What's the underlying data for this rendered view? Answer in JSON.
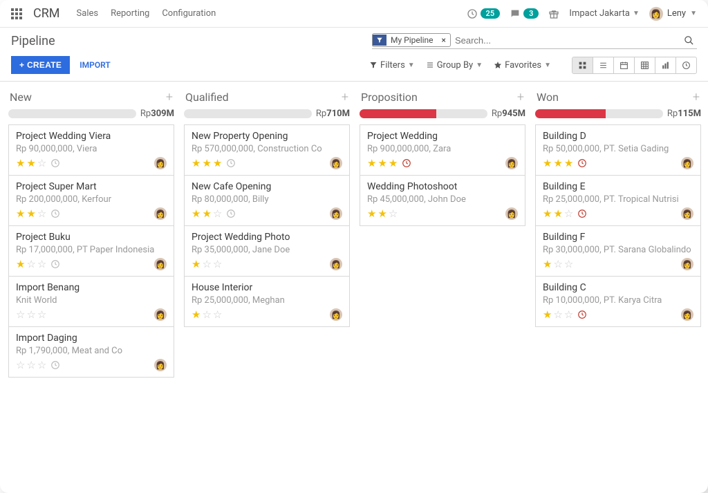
{
  "topbar": {
    "brand": "CRM",
    "nav": [
      "Sales",
      "Reporting",
      "Configuration"
    ],
    "activity_count": "25",
    "message_count": "3",
    "company": "Impact Jakarta",
    "user": "Leny"
  },
  "subbar": {
    "title": "Pipeline",
    "filter_chip": "My Pipeline",
    "search_placeholder": "Search..."
  },
  "toolbar": {
    "create": "CREATE",
    "import": "IMPORT",
    "filters": "Filters",
    "groupby": "Group By",
    "favorites": "Favorites"
  },
  "columns": [
    {
      "name": "New",
      "currency": "Rp",
      "total": "309M",
      "fill": 0,
      "cards": [
        {
          "title": "Project Wedding Viera",
          "sub": "Rp 90,000,000, Viera",
          "stars": 2,
          "clock": "grey"
        },
        {
          "title": "Project Super Mart",
          "sub": "Rp 200,000,000, Kerfour",
          "stars": 2,
          "clock": "grey"
        },
        {
          "title": "Project Buku",
          "sub": "Rp 17,000,000, PT Paper Indonesia",
          "stars": 1,
          "clock": "grey"
        },
        {
          "title": "Import Benang",
          "sub": "Knit World",
          "stars": 0,
          "clock": "none"
        },
        {
          "title": "Import Daging",
          "sub": "Rp 1,790,000, Meat and Co",
          "stars": 0,
          "clock": "grey"
        }
      ]
    },
    {
      "name": "Qualified",
      "currency": "Rp",
      "total": "710M",
      "fill": 0,
      "cards": [
        {
          "title": "New Property Opening",
          "sub": "Rp 570,000,000, Construction Co",
          "stars": 3,
          "clock": "grey"
        },
        {
          "title": "New Cafe Opening",
          "sub": "Rp 80,000,000, Billy",
          "stars": 2,
          "clock": "grey"
        },
        {
          "title": "Project Wedding Photo",
          "sub": "Rp 35,000,000, Jane Doe",
          "stars": 1,
          "clock": "none"
        },
        {
          "title": "House Interior",
          "sub": "Rp 25,000,000, Meghan",
          "stars": 1,
          "clock": "none"
        }
      ]
    },
    {
      "name": "Proposition",
      "currency": "Rp",
      "total": "945M",
      "fill": 60,
      "cards": [
        {
          "title": "Project Wedding",
          "sub": "Rp 900,000,000, Zara",
          "stars": 3,
          "clock": "red"
        },
        {
          "title": "Wedding Photoshoot",
          "sub": "Rp 45,000,000, John Doe",
          "stars": 2,
          "clock": "none"
        }
      ]
    },
    {
      "name": "Won",
      "currency": "Rp",
      "total": "115M",
      "fill": 55,
      "cards": [
        {
          "title": "Building D",
          "sub": "Rp 50,000,000, PT. Setia Gading",
          "stars": 3,
          "clock": "red"
        },
        {
          "title": "Building E",
          "sub": "Rp 25,000,000, PT. Tropical Nutrisi",
          "stars": 2,
          "clock": "red"
        },
        {
          "title": "Building F",
          "sub": "Rp 30,000,000, PT. Sarana Globalindo",
          "stars": 1,
          "clock": "none"
        },
        {
          "title": "Building C",
          "sub": "Rp 10,000,000, PT. Karya Citra",
          "stars": 1,
          "clock": "red"
        }
      ]
    }
  ]
}
